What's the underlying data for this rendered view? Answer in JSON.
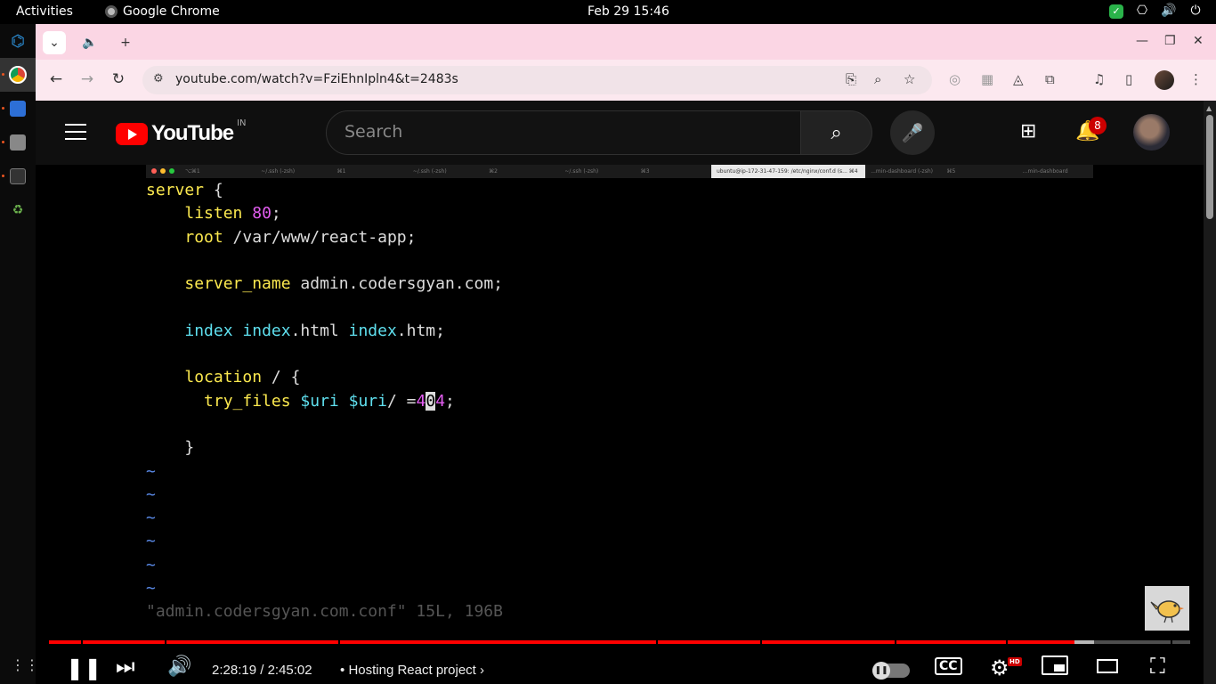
{
  "system": {
    "activities": "Activities",
    "app_name": "Google Chrome",
    "clock": "Feb 29  15:46"
  },
  "browser": {
    "url": "youtube.com/watch?v=FziEhnIpln4&t=2483s"
  },
  "youtube": {
    "logo_text": "YouTube",
    "country_code": "IN",
    "search_placeholder": "Search",
    "notification_count": "8"
  },
  "terminal": {
    "tabs": [
      {
        "label": "⌥⌘1",
        "active": false
      },
      {
        "label": "~/.ssh (-zsh)",
        "active": false
      },
      {
        "label": "⌘1",
        "active": false
      },
      {
        "label": "~/.ssh (-zsh)",
        "active": false
      },
      {
        "label": "⌘2",
        "active": false
      },
      {
        "label": "~/.ssh (-zsh)",
        "active": false
      },
      {
        "label": "⌘3",
        "active": false
      },
      {
        "label": "ubuntu@ip-172-31-47-159: /etc/nginx/conf.d (s...  ⌘4",
        "active": true
      },
      {
        "label": "...min-dashboard (-zsh)",
        "active": false
      },
      {
        "label": "⌘5",
        "active": false
      },
      {
        "label": "...min-dashboard",
        "active": false
      }
    ],
    "code": {
      "l1_kw": "server",
      "l1_rest": " {",
      "l2_kw": "listen",
      "l2_num": "80",
      "l2_rest": ";",
      "l3_kw": "root",
      "l3_rest": " /var/www/react-app;",
      "l4_kw": "server_name",
      "l4_rest": " admin.codersgyan.com;",
      "l5_a": "index",
      "l5_b": "index",
      "l5_c": ".html ",
      "l5_d": "index",
      "l5_e": ".htm;",
      "l6_kw": "location",
      "l6_rest": " / {",
      "l7_kw": "try_files",
      "l7_v1": "$uri",
      "l7_v2": "$uri",
      "l7_mid": "/ =",
      "l7_n1": "4",
      "l7_cur": "0",
      "l7_n2": "4",
      "l7_end": ";",
      "l8": "}",
      "l9": "}",
      "tilde": "~",
      "status_partial": "\"admin.codersgyan.com.conf\" 15L, 196B"
    }
  },
  "player": {
    "time_current": "2:28:19",
    "time_total": "2:45:02",
    "time_separator": " / ",
    "chapter_bullet": "•",
    "chapter_title": "Hosting React project",
    "hd_badge": "HD",
    "progress_fraction": 0.8987,
    "buffered_fraction": 0.9156
  },
  "colors": {
    "accent_red": "#ff0000",
    "tab_strip": "#fbd6e4"
  }
}
